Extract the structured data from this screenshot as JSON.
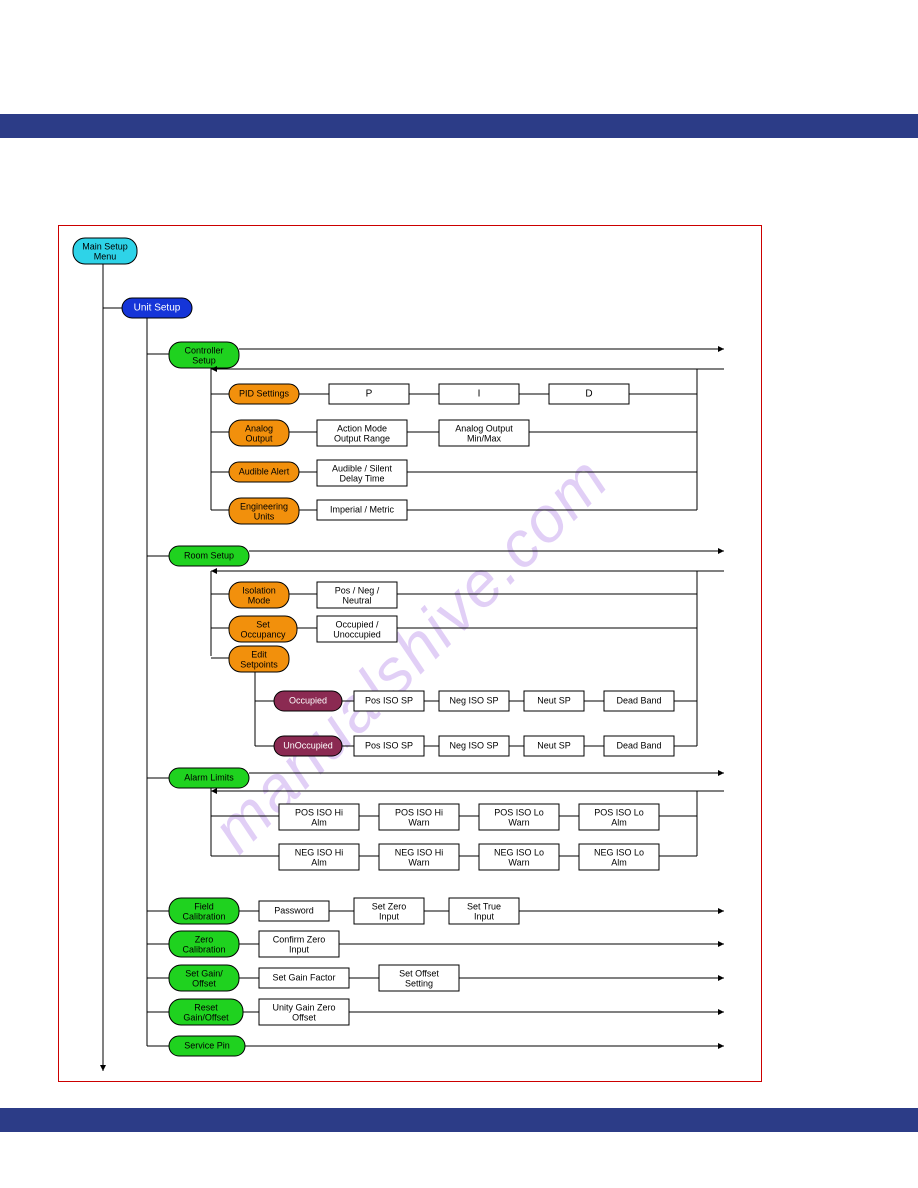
{
  "watermark": "manualshive.com",
  "root": "Main Setup Menu",
  "unit_setup": "Unit Setup",
  "controller_setup": "Controller Setup",
  "pid_settings": {
    "label": "PID Settings",
    "p": "P",
    "i": "I",
    "d": "D"
  },
  "analog_output": {
    "label": "Analog Output",
    "box1_a": "Action Mode",
    "box1_b": "Output Range",
    "box2_a": "Analog Output",
    "box2_b": "Min/Max"
  },
  "audible_alert": {
    "label": "Audible Alert",
    "box_a": "Audible / Silent",
    "box_b": "Delay Time"
  },
  "eng_units": {
    "label": "Engineering Units",
    "box": "Imperial / Metric"
  },
  "room_setup": "Room Setup",
  "iso_mode": {
    "label": "Isolation Mode",
    "box_a": "Pos / Neg /",
    "box_b": "Neutral"
  },
  "set_occ": {
    "label": "Set Occupancy",
    "box_a": "Occupied /",
    "box_b": "Unoccupied"
  },
  "edit_setpoints": "Edit Setpoints",
  "occupied": {
    "label": "Occupied",
    "b1": "Pos ISO SP",
    "b2": "Neg ISO SP",
    "b3": "Neut SP",
    "b4": "Dead Band"
  },
  "unoccupied": {
    "label": "UnOccupied",
    "b1": "Pos ISO SP",
    "b2": "Neg ISO SP",
    "b3": "Neut SP",
    "b4": "Dead Band"
  },
  "alarm_limits": "Alarm Limits",
  "alarms_row1": {
    "b1a": "POS ISO Hi",
    "b1b": "Alm",
    "b2a": "POS ISO Hi",
    "b2b": "Warn",
    "b3a": "POS ISO Lo",
    "b3b": "Warn",
    "b4a": "POS ISO Lo",
    "b4b": "Alm"
  },
  "alarms_row2": {
    "b1a": "NEG ISO Hi",
    "b1b": "Alm",
    "b2a": "NEG ISO Hi",
    "b2b": "Warn",
    "b3a": "NEG ISO Lo",
    "b3b": "Warn",
    "b4a": "NEG ISO Lo",
    "b4b": "Alm"
  },
  "field_cal": {
    "label": "Field Calibration",
    "b1": "Password",
    "b2a": "Set Zero",
    "b2b": "Input",
    "b3a": "Set True",
    "b3b": "Input"
  },
  "zero_cal": {
    "label": "Zero Calibration",
    "b1a": "Confirm Zero",
    "b1b": "Input"
  },
  "set_gain": {
    "label": "Set Gain/ Offset",
    "b1": "Set Gain Factor",
    "b2a": "Set Offset",
    "b2b": "Setting"
  },
  "reset_gain": {
    "label": "Reset Gain/Offset",
    "b1a": "Unity Gain Zero",
    "b1b": "Offset"
  },
  "service_pin": "Service Pin"
}
